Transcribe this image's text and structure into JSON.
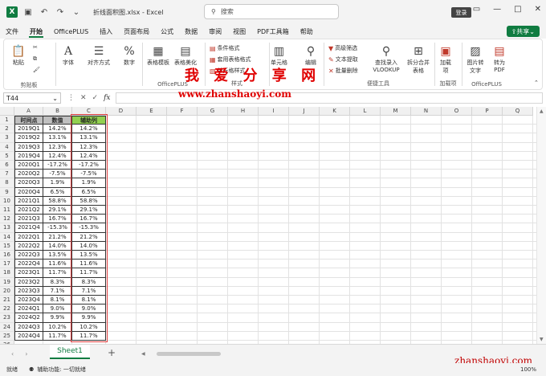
{
  "window": {
    "file_name": "折线面积图.xlsx  -  Excel",
    "search_placeholder": "搜索",
    "login_label": "登录",
    "share_label": "共享"
  },
  "menu": [
    "文件",
    "开始",
    "OfficePLUS",
    "插入",
    "页面布局",
    "公式",
    "数据",
    "审阅",
    "视图",
    "PDF工具箱",
    "帮助"
  ],
  "ribbon": {
    "clipboard": {
      "paste": "粘贴",
      "label": "剪贴板"
    },
    "font": "字体",
    "align": "对齐方式",
    "number": "数字",
    "table_template": "表格模板",
    "table_beautify": "表格美化",
    "officeplus_label": "OfficePLUS",
    "cond_format": "条件格式",
    "table_format": "套用表格格式",
    "cell_style": "单元格样式",
    "style_label": "样式",
    "cells": "单元格",
    "edit": "编辑",
    "adv_filter": "高级筛选",
    "text_extract": "文本提取",
    "batch_delete": "批量删除",
    "lookup": "查找录入VLOOKUP",
    "split_merge": "拆分合并表格",
    "tools_label": "便捷工具",
    "addin": "加载项",
    "addin_label": "加载项",
    "img_text": "图片转文字",
    "to_pdf": "转为PDF",
    "officeplus2_label": "OfficePLUS"
  },
  "formula": {
    "namebox": "T44",
    "fx": "fx"
  },
  "watermark": {
    "cn": "我 爱 分 享 网",
    "url": "www.zhanshaoyi.com",
    "footer": "zhanshaoyi.com"
  },
  "columns": [
    "A",
    "B",
    "C",
    "D",
    "E",
    "F",
    "G",
    "H",
    "I",
    "J",
    "K",
    "L",
    "M",
    "N",
    "O",
    "P",
    "Q"
  ],
  "rows": [
    "1",
    "2",
    "3",
    "4",
    "5",
    "6",
    "7",
    "8",
    "9",
    "10",
    "11",
    "12",
    "13",
    "14",
    "15",
    "16",
    "17",
    "18",
    "19",
    "20",
    "21",
    "22",
    "23",
    "24",
    "25",
    "26"
  ],
  "table": {
    "headers": [
      "时间点",
      "数值",
      "辅助列"
    ],
    "rows": [
      [
        "2019Q1",
        "14.2%",
        "14.2%"
      ],
      [
        "2019Q2",
        "13.1%",
        "13.1%"
      ],
      [
        "2019Q3",
        "12.3%",
        "12.3%"
      ],
      [
        "2019Q4",
        "12.4%",
        "12.4%"
      ],
      [
        "2020Q1",
        "-17.2%",
        "-17.2%"
      ],
      [
        "2020Q2",
        "-7.5%",
        "-7.5%"
      ],
      [
        "2020Q3",
        "1.9%",
        "1.9%"
      ],
      [
        "2020Q4",
        "6.5%",
        "6.5%"
      ],
      [
        "2021Q1",
        "58.8%",
        "58.8%"
      ],
      [
        "2021Q2",
        "29.1%",
        "29.1%"
      ],
      [
        "2021Q3",
        "16.7%",
        "16.7%"
      ],
      [
        "2021Q4",
        "-15.3%",
        "-15.3%"
      ],
      [
        "2022Q1",
        "21.2%",
        "21.2%"
      ],
      [
        "2022Q2",
        "14.0%",
        "14.0%"
      ],
      [
        "2022Q3",
        "13.5%",
        "13.5%"
      ],
      [
        "2022Q4",
        "11.6%",
        "11.6%"
      ],
      [
        "2023Q1",
        "11.7%",
        "11.7%"
      ],
      [
        "2023Q2",
        "8.3%",
        "8.3%"
      ],
      [
        "2023Q3",
        "7.1%",
        "7.1%"
      ],
      [
        "2023Q4",
        "8.1%",
        "8.1%"
      ],
      [
        "2024Q1",
        "9.0%",
        "9.0%"
      ],
      [
        "2024Q2",
        "9.9%",
        "9.9%"
      ],
      [
        "2024Q3",
        "10.2%",
        "10.2%"
      ],
      [
        "2024Q4",
        "11.7%",
        "11.7%"
      ]
    ]
  },
  "sheet_tab": "Sheet1",
  "status": {
    "ready": "就绪",
    "accessibility": "辅助功能: 一切就绪",
    "zoom": "100%"
  },
  "colors": {
    "accent": "#107c41",
    "header_gray": "#bfbfbf",
    "header_green": "#92d050",
    "watermark": "#e00000"
  }
}
